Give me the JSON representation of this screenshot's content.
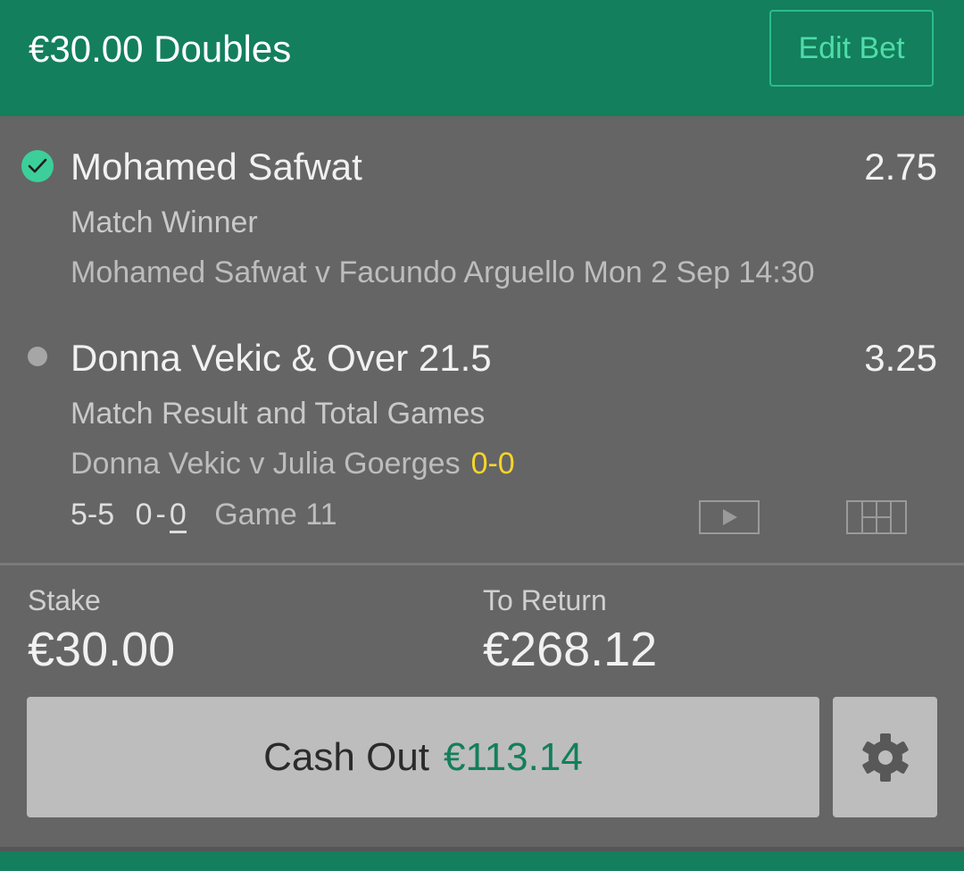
{
  "header": {
    "title": "€30.00 Doubles",
    "edit_label": "Edit Bet"
  },
  "selections": [
    {
      "status": "won",
      "name": "Mohamed Safwat",
      "odds": "2.75",
      "market": "Match Winner",
      "event": "Mohamed Safwat v Facundo Arguello Mon 2 Sep 14:30"
    },
    {
      "status": "open",
      "name": "Donna Vekic & Over 21.5",
      "odds": "3.25",
      "market": "Match Result and Total Games",
      "event": "Donna Vekic v Julia Goerges",
      "live_score": "0-0",
      "set_score": "5-5",
      "points_home": "0",
      "points_sep": "-",
      "points_away": "0",
      "game_label": "Game 11"
    }
  ],
  "footer": {
    "stake_label": "Stake",
    "stake_value": "€30.00",
    "return_label": "To Return",
    "return_value": "€268.12",
    "cashout_label": "Cash Out",
    "cashout_amount": "€113.14"
  },
  "icons": {
    "won": "check-circle-icon",
    "open": "dot-icon",
    "video": "play-video-icon",
    "tracker": "match-tracker-icon",
    "settings": "gear-icon"
  },
  "colors": {
    "brand": "#137f5c",
    "accent": "#3ccf9a",
    "live_score": "#f7d42b",
    "panel": "#656565"
  }
}
